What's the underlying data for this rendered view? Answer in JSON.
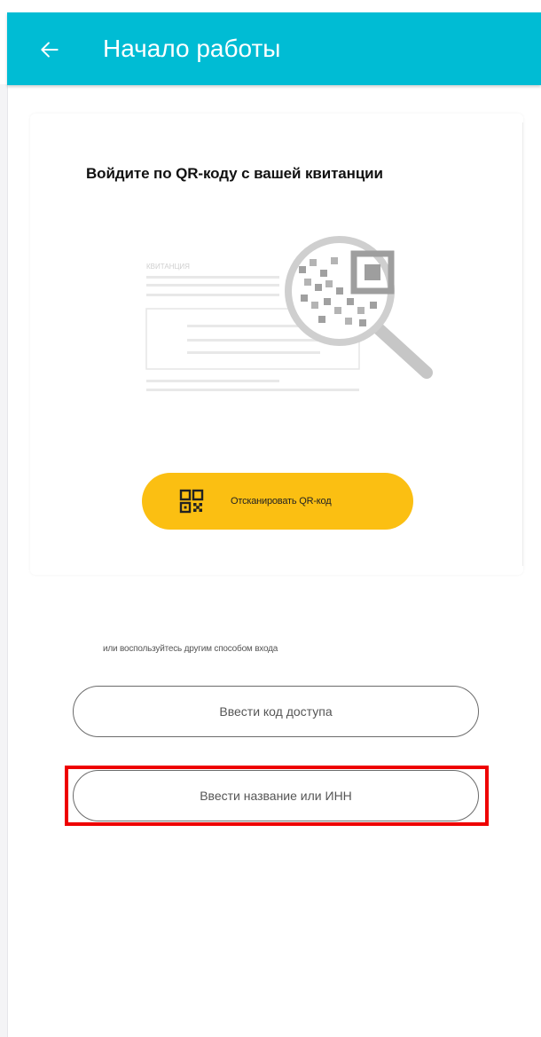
{
  "header": {
    "title": "Начало работы",
    "back_icon": "arrow-left-icon",
    "background_color": "#00bcd4"
  },
  "qr_card": {
    "heading": "Войдите по QR-коду с вашей квитанции",
    "illustration_label": "КВИТАНЦИЯ",
    "scan_button": {
      "label": "Отсканировать QR-код",
      "icon": "qr-code-icon",
      "color": "#fbbf12"
    }
  },
  "alternative": {
    "text": "или воспользуйтесь другим способом входа",
    "buttons": [
      {
        "label": "Ввести код доступа"
      },
      {
        "label": "Ввести название или ИНН"
      }
    ]
  },
  "highlight_color": "#ee0000"
}
